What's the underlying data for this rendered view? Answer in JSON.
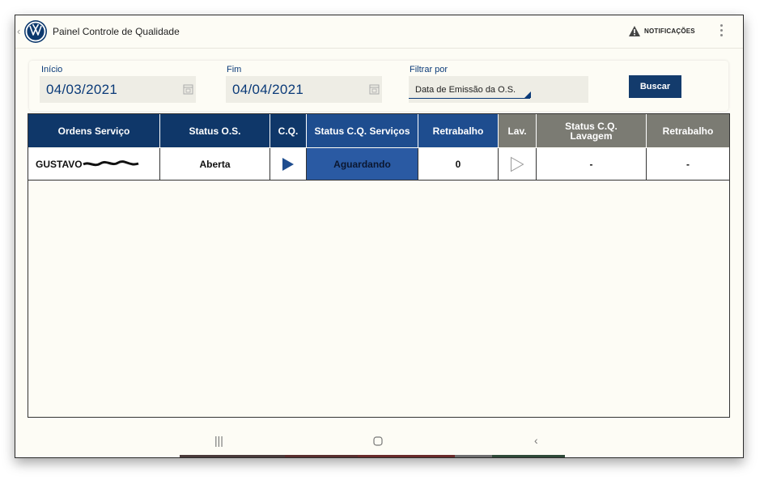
{
  "app": {
    "title": "Painel Controle de Qualidade",
    "notifications_label": "NOTIFICAÇÕES",
    "logo_icon": "vw-logo-icon",
    "accent": "#133b6c"
  },
  "filters": {
    "inicio_label": "Início",
    "inicio_value": "04/03/2021",
    "fim_label": "Fim",
    "fim_value": "04/04/2021",
    "filtrar_label": "Filtrar por",
    "filtrar_value": "Data de Emissão da O.S.",
    "search_button": "Buscar"
  },
  "table": {
    "headers": [
      "Ordens Serviço",
      "Status O.S.",
      "C.Q.",
      "Status C.Q. Serviços",
      "Retrabalho",
      "Lav.",
      "Status C.Q. Lavagem",
      "Retrabalho"
    ],
    "rows": [
      {
        "ordem": "GUSTAVO",
        "status_os": "Aberta",
        "cq_icon": "play-filled-icon",
        "status_cq_servicos": "Aguardando",
        "retrabalho": "0",
        "lav_icon": "play-outline-icon",
        "status_cq_lavagem": "-",
        "retrabalho_lavagem": "-"
      }
    ]
  },
  "colors": {
    "header_dark": "#0f3769",
    "header_mid": "#1e4d8f",
    "header_gray": "#7b7b73",
    "status_blue": "#2a5aa3"
  }
}
